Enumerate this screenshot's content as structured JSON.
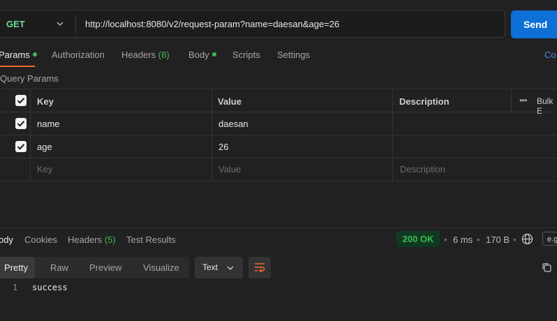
{
  "request": {
    "method": "GET",
    "url": "http://localhost:8080/v2/request-param?name=daesan&age=26",
    "send_label": "Send"
  },
  "request_tabs": {
    "params": "Params",
    "authorization": "Authorization",
    "headers": "Headers",
    "headers_count": "(8)",
    "body": "Body",
    "scripts": "Scripts",
    "settings": "Settings",
    "cookies": "Co"
  },
  "query_params": {
    "title": "Query Params",
    "columns": {
      "key": "Key",
      "value": "Value",
      "description": "Description",
      "bulk_edit": "Bulk E"
    },
    "rows": [
      {
        "key": "name",
        "value": "daesan",
        "description": ""
      },
      {
        "key": "age",
        "value": "26",
        "description": ""
      }
    ],
    "placeholder": {
      "key": "Key",
      "value": "Value",
      "description": "Description"
    }
  },
  "response_tabs": {
    "body": "ody",
    "cookies": "Cookies",
    "headers": "Headers",
    "headers_count": "(5)",
    "test_results": "Test Results"
  },
  "response_meta": {
    "status": "200 OK",
    "time": "6 ms",
    "size": "170 B",
    "save": "e.g"
  },
  "view_modes": {
    "pretty": "Pretty",
    "raw": "Raw",
    "preview": "Preview",
    "visualize": "Visualize"
  },
  "format": "Text",
  "response_body": {
    "line_number": "1",
    "text": "success"
  },
  "colors": {
    "accent": "#ff6c37",
    "send": "#0e70d6",
    "success": "#3fb950",
    "method": "#6bdd9a"
  }
}
